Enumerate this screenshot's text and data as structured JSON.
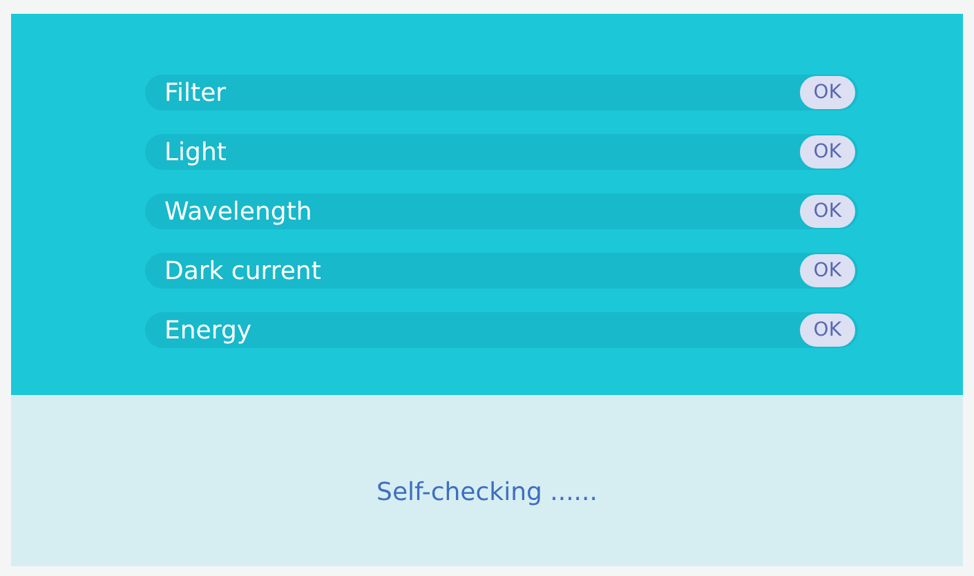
{
  "checks": [
    {
      "label": "Filter",
      "status": "OK"
    },
    {
      "label": "Light",
      "status": "OK"
    },
    {
      "label": "Wavelength",
      "status": "OK"
    },
    {
      "label": "Dark current",
      "status": "OK"
    },
    {
      "label": "Energy",
      "status": "OK"
    }
  ],
  "status_message": "Self-checking ......"
}
